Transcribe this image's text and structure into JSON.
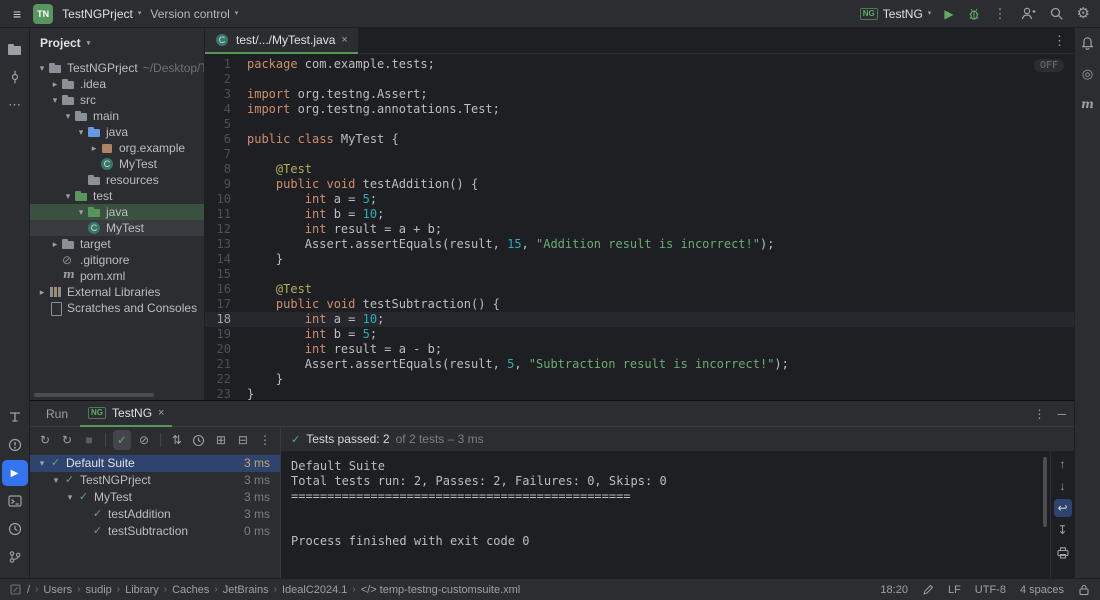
{
  "icons": {
    "menu": "≡",
    "chevron": "▾",
    "expanded": "▾",
    "collapsed": "▸",
    "more_v": "⋮",
    "more_h": "⋯",
    "close": "×",
    "play": "▶",
    "stop": "■",
    "check": "✓",
    "rerun": "↻",
    "ignored": "⊘",
    "sort": "⇅",
    "expand_all": "⊞",
    "collapse_all": "⊟",
    "up": "↑",
    "down": "↓",
    "wrap": "↩",
    "scroll_end": "↧",
    "gear": "⚙",
    "coverage": "◎",
    "maven": "m",
    "minimize": "─",
    "crumb_sep": "›",
    "code_tag": "</>"
  },
  "top_bar": {
    "project_badge": "TN",
    "project_name": "TestNGPrject",
    "vcs_label": "Version control",
    "run_config_badge": "NG",
    "run_config_name": "TestNG"
  },
  "project_panel": {
    "title": "Project",
    "tree": [
      {
        "depth": 0,
        "chev": "down",
        "icon": "folder",
        "label": "TestNGPrject",
        "suffix": "~/Desktop/Te"
      },
      {
        "depth": 1,
        "chev": "right",
        "icon": "folder",
        "label": ".idea"
      },
      {
        "depth": 1,
        "chev": "down",
        "icon": "folder",
        "label": "src"
      },
      {
        "depth": 2,
        "chev": "down",
        "icon": "folder",
        "label": "main"
      },
      {
        "depth": 3,
        "chev": "down",
        "icon": "folder-src",
        "label": "java"
      },
      {
        "depth": 4,
        "chev": "right",
        "icon": "package",
        "label": "org.example"
      },
      {
        "depth": 4,
        "chev": "none",
        "icon": "class",
        "label": "MyTest"
      },
      {
        "depth": 3,
        "chev": "none",
        "icon": "folder",
        "label": "resources"
      },
      {
        "depth": 2,
        "chev": "down",
        "icon": "folder-test",
        "label": "test"
      },
      {
        "depth": 3,
        "chev": "down",
        "icon": "folder-test",
        "label": "java",
        "highlight": "green"
      },
      {
        "depth": 3,
        "chev": "none",
        "icon": "class",
        "label": "MyTest",
        "highlight": "selected"
      },
      {
        "depth": 1,
        "chev": "right",
        "icon": "folder",
        "label": "target"
      },
      {
        "depth": 1,
        "chev": "none",
        "icon": "ignored",
        "label": ".gitignore"
      },
      {
        "depth": 1,
        "chev": "none",
        "icon": "maven",
        "label": "pom.xml"
      },
      {
        "depth": 0,
        "chev": "right",
        "icon": "lib",
        "label": "External Libraries"
      },
      {
        "depth": 0,
        "chev": "none",
        "icon": "file",
        "label": "Scratches and Consoles"
      }
    ]
  },
  "editor": {
    "tab_title": "test/.../MyTest.java",
    "off_label": "OFF",
    "current_line": 18,
    "code": [
      [
        [
          "kw",
          "package "
        ],
        [
          "t",
          "com.example.tests;"
        ]
      ],
      [],
      [
        [
          "kw",
          "import "
        ],
        [
          "t",
          "org.testng.Assert;"
        ]
      ],
      [
        [
          "kw",
          "import "
        ],
        [
          "t",
          "org.testng.annotations.Test;"
        ]
      ],
      [],
      [
        [
          "kw",
          "public class "
        ],
        [
          "t",
          "MyTest {"
        ]
      ],
      [],
      [
        [
          "ann",
          "    @Test"
        ]
      ],
      [
        [
          "kw",
          "    public void "
        ],
        [
          "t",
          "testAddition() {"
        ]
      ],
      [
        [
          "kw",
          "        int "
        ],
        [
          "t",
          "a = "
        ],
        [
          "num",
          "5"
        ],
        [
          "t",
          ";"
        ]
      ],
      [
        [
          "kw",
          "        int "
        ],
        [
          "t",
          "b = "
        ],
        [
          "num",
          "10"
        ],
        [
          "t",
          ";"
        ]
      ],
      [
        [
          "kw",
          "        int "
        ],
        [
          "t",
          "result = a + b;"
        ]
      ],
      [
        [
          "t",
          "        Assert.assertEquals(result, "
        ],
        [
          "num",
          "15"
        ],
        [
          "t",
          ", "
        ],
        [
          "str",
          "\"Addition result is incorrect!\""
        ],
        [
          "t",
          ");"
        ]
      ],
      [
        [
          "t",
          "    }"
        ]
      ],
      [],
      [
        [
          "ann",
          "    @Test"
        ]
      ],
      [
        [
          "kw",
          "    public void "
        ],
        [
          "t",
          "testSubtraction() {"
        ]
      ],
      [
        [
          "kw",
          "        int "
        ],
        [
          "t",
          "a = "
        ],
        [
          "num",
          "10"
        ],
        [
          "t",
          ";"
        ]
      ],
      [
        [
          "kw",
          "        int "
        ],
        [
          "t",
          "b = "
        ],
        [
          "num",
          "5"
        ],
        [
          "t",
          ";"
        ]
      ],
      [
        [
          "kw",
          "        int "
        ],
        [
          "t",
          "result = a - b;"
        ]
      ],
      [
        [
          "t",
          "        Assert.assertEquals(result, "
        ],
        [
          "num",
          "5"
        ],
        [
          "t",
          ", "
        ],
        [
          "str",
          "\"Subtraction result is incorrect!\""
        ],
        [
          "t",
          ");"
        ]
      ],
      [
        [
          "t",
          "    }"
        ]
      ],
      [
        [
          "t",
          "}"
        ]
      ]
    ]
  },
  "run_panel": {
    "tab_run": "Run",
    "tab_active": "TestNG",
    "tab_active_badge": "NG",
    "summary_main": "Tests passed: 2",
    "summary_rest": "of 2 tests – 3 ms",
    "tree": [
      {
        "depth": 0,
        "expanded": true,
        "label": "Default Suite",
        "time": "3 ms",
        "selected": true
      },
      {
        "depth": 1,
        "expanded": true,
        "label": "TestNGPrject",
        "time": "3 ms"
      },
      {
        "depth": 2,
        "expanded": true,
        "label": "MyTest",
        "time": "3 ms"
      },
      {
        "depth": 3,
        "expanded": false,
        "label": "testAddition",
        "time": "3 ms"
      },
      {
        "depth": 3,
        "expanded": false,
        "label": "testSubtraction",
        "time": "0 ms"
      }
    ],
    "console_lines": [
      "Default Suite",
      "Total tests run: 2, Passes: 2, Failures: 0, Skips: 0",
      "===============================================",
      "",
      "",
      "Process finished with exit code 0"
    ]
  },
  "status_bar": {
    "breadcrumbs": [
      "/",
      "Users",
      "sudip",
      "Library",
      "Caches",
      "JetBrains",
      "IdealC2024.1"
    ],
    "file_crumb": "temp-testng-customsuite.xml",
    "time": "18:20",
    "line_sep": "LF",
    "encoding": "UTF-8",
    "indent": "4 spaces"
  }
}
